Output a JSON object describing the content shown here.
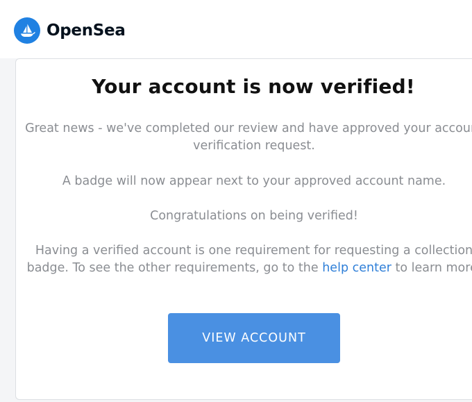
{
  "header": {
    "logo_icon": "opensea-boat-icon",
    "brand_name": "OpenSea"
  },
  "email": {
    "headline": "Your account is now verified!",
    "paragraph_1": "Great news - we've completed our review and have approved your account verification request.",
    "paragraph_2": "A badge will now appear next to your approved account name.",
    "paragraph_3": "Congratulations on being verified!",
    "paragraph_4_before_link": "Having a verified account is one requirement for requesting a collection badge. To see the other requirements, go to the ",
    "paragraph_4_link": "help center",
    "paragraph_4_after_link": " to learn more.",
    "cta_label": "VIEW ACCOUNT"
  },
  "colors": {
    "brand_blue": "#2081e2",
    "button_blue": "#4a90e2",
    "link_blue": "#2f7fd8",
    "body_text": "#8a8d92",
    "headline_text": "#111111"
  }
}
